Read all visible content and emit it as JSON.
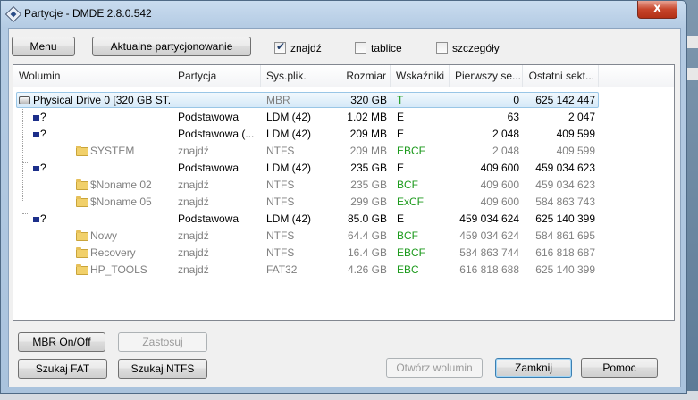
{
  "window": {
    "title": "Partycje - DMDE 2.8.0.542",
    "close_label": "x"
  },
  "toolbar": {
    "menu_label": "Menu",
    "current_partitioning_label": "Aktualne partycjonowanie",
    "checkboxes": [
      {
        "label": "znajdź",
        "checked": true
      },
      {
        "label": "tablice",
        "checked": false
      },
      {
        "label": "szczegóły",
        "checked": false
      }
    ]
  },
  "table": {
    "columns": [
      "Wolumin",
      "Partycja",
      "Sys.plik.",
      "Rozmiar",
      "Wskaźniki",
      "Pierwszy se...",
      "Ostatni sekt..."
    ],
    "rows": [
      {
        "volume": "Physical Drive 0 [320 GB ST...",
        "partition": "",
        "fs": "MBR",
        "size": "320 GB",
        "flags": "T",
        "first": "0",
        "last": "625 142 447",
        "icon": "disk-icon"
      },
      {
        "volume": "?",
        "partition": "Podstawowa",
        "fs": "LDM (42)",
        "size": "1.02 MB",
        "flags": "E",
        "first": "63",
        "last": "2 047",
        "icon": "partition-icon"
      },
      {
        "volume": "?",
        "partition": "Podstawowa (...",
        "fs": "LDM (42)",
        "size": "209 MB",
        "flags": "E",
        "first": "2 048",
        "last": "409 599",
        "icon": "partition-icon"
      },
      {
        "volume": "SYSTEM",
        "partition": "znajdź",
        "fs": "NTFS",
        "size": "209 MB",
        "flags": "EBCF",
        "first": "2 048",
        "last": "409 599",
        "icon": "folder-icon"
      },
      {
        "volume": "?",
        "partition": "Podstawowa",
        "fs": "LDM (42)",
        "size": "235 GB",
        "flags": "E",
        "first": "409 600",
        "last": "459 034 623",
        "icon": "partition-icon"
      },
      {
        "volume": "$Noname 02",
        "partition": "znajdź",
        "fs": "NTFS",
        "size": "235 GB",
        "flags": " BCF",
        "first": "409 600",
        "last": "459 034 623",
        "icon": "folder-icon"
      },
      {
        "volume": "$Noname 05",
        "partition": "znajdź",
        "fs": "NTFS",
        "size": "299 GB",
        "flags": "ExCF",
        "first": "409 600",
        "last": "584 863 743",
        "icon": "folder-icon"
      },
      {
        "volume": "?",
        "partition": "Podstawowa",
        "fs": "LDM (42)",
        "size": "85.0 GB",
        "flags": "E",
        "first": "459 034 624",
        "last": "625 140 399",
        "icon": "partition-icon"
      },
      {
        "volume": "Nowy",
        "partition": "znajdź",
        "fs": "NTFS",
        "size": "64.4 GB",
        "flags": " BCF",
        "first": "459 034 624",
        "last": "584 861 695",
        "icon": "folder-icon"
      },
      {
        "volume": "Recovery",
        "partition": "znajdź",
        "fs": "NTFS",
        "size": "16.4 GB",
        "flags": "EBCF",
        "first": "584 863 744",
        "last": "616 818 687",
        "icon": "folder-icon"
      },
      {
        "volume": "HP_TOOLS",
        "partition": "znajdź",
        "fs": "FAT32",
        "size": "4.26 GB",
        "flags": "EBC",
        "first": "616 818 688",
        "last": "625 140 399",
        "icon": "folder-icon"
      }
    ]
  },
  "buttons": {
    "mbr_onoff": "MBR On/Off",
    "apply": "Zastosuj",
    "search_fat": "Szukaj FAT",
    "search_ntfs": "Szukaj NTFS",
    "open_volume": "Otwórz wolumin",
    "close": "Zamknij",
    "help": "Pomoc"
  },
  "colors": {
    "flag_green": "#1c9a1c",
    "selection": "#d5e9f8",
    "close_red": "#c7452b"
  }
}
